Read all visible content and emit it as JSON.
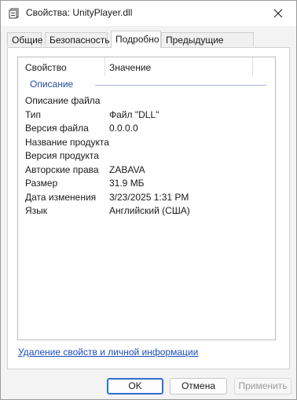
{
  "window": {
    "title": "Свойства: UnityPlayer.dll"
  },
  "tabs": [
    {
      "label": "Общие"
    },
    {
      "label": "Безопасность"
    },
    {
      "label": "Подробно",
      "active": true
    },
    {
      "label": "Предыдущие версии"
    }
  ],
  "details": {
    "col_property": "Свойство",
    "col_value": "Значение",
    "group": "Описание",
    "rows": [
      {
        "key": "Описание файла",
        "value": ""
      },
      {
        "key": "Тип",
        "value": "Файл \"DLL\""
      },
      {
        "key": "Версия файла",
        "value": "0.0.0.0"
      },
      {
        "key": "Название продукта",
        "value": ""
      },
      {
        "key": "Версия продукта",
        "value": ""
      },
      {
        "key": "Авторские права",
        "value": "ZABAVA"
      },
      {
        "key": "Размер",
        "value": "31.9 МБ"
      },
      {
        "key": "Дата изменения",
        "value": "3/23/2025 1:31 PM"
      },
      {
        "key": "Язык",
        "value": "Английский (США)"
      }
    ]
  },
  "footer": {
    "remove_link": "Удаление свойств и личной информации",
    "ok": "OK",
    "cancel": "Отмена",
    "apply": "Применить"
  }
}
